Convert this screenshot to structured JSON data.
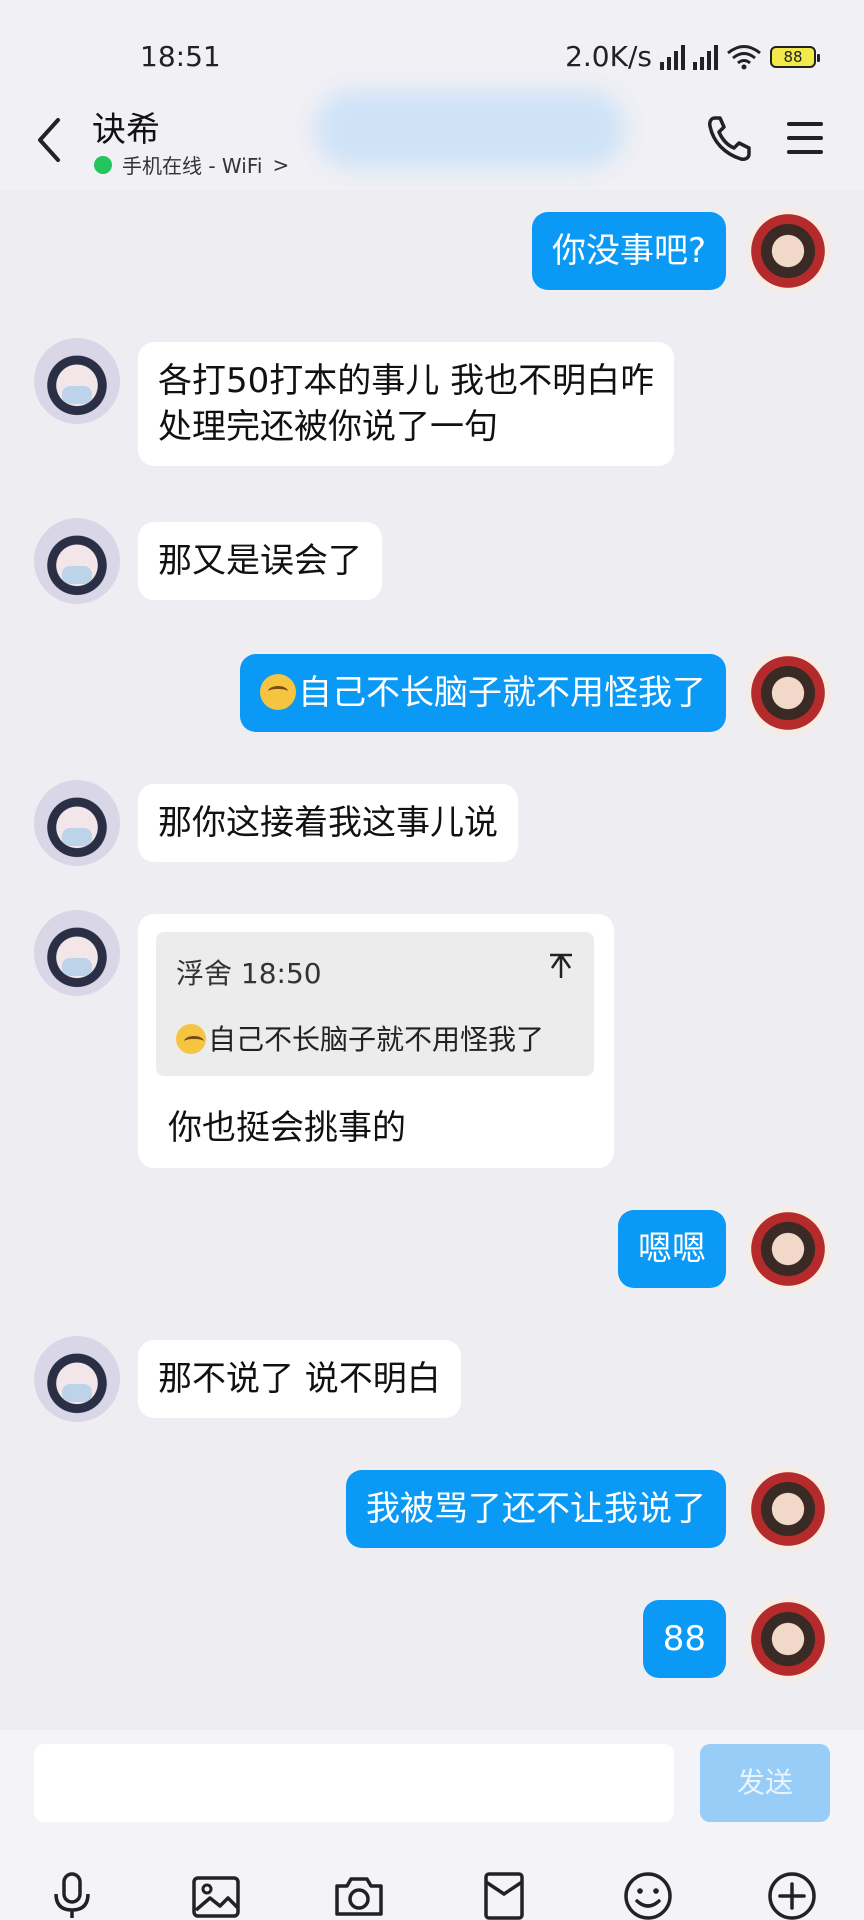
{
  "status_bar": {
    "time": "18:51",
    "network_speed": "2.0K/s",
    "battery": "88"
  },
  "header": {
    "contact_name": "诀希",
    "online_status": "手机在线 - WiFi",
    "online_chevron": ">",
    "icons": [
      "back-icon",
      "phone-icon",
      "menu-icon"
    ]
  },
  "messages": [
    {
      "side": "out",
      "text": "你没事吧?"
    },
    {
      "side": "in",
      "lines": [
        "各打50打本的事儿 我也不明白咋",
        "处理完还被你说了一句"
      ]
    },
    {
      "side": "in",
      "text": "那又是误会了"
    },
    {
      "side": "out",
      "text": "自己不长脑子就不用怪我了",
      "emoji": "smile-emoji"
    },
    {
      "side": "in",
      "text": "那你这接着我这事儿说"
    },
    {
      "side": "in",
      "quote": {
        "author": "浮舍 18:50",
        "text": "自己不长脑子就不用怪我了",
        "emoji": "smile-emoji"
      },
      "text": "你也挺会挑事的"
    },
    {
      "side": "out",
      "text": "嗯嗯"
    },
    {
      "side": "in",
      "text": "那不说了 说不明白"
    },
    {
      "side": "out",
      "text": "我被骂了还不让我说了"
    },
    {
      "side": "out",
      "text": "88"
    }
  ],
  "input": {
    "value": "",
    "send_label": "发送"
  },
  "toolbar_icons": [
    "microphone-icon",
    "image-icon",
    "camera-icon",
    "red-packet-icon",
    "emoji-icon",
    "plus-icon"
  ],
  "colors": {
    "outgoing_bubble": "#0a9af6",
    "incoming_bubble": "#ffffff",
    "background": "#ededf2"
  }
}
